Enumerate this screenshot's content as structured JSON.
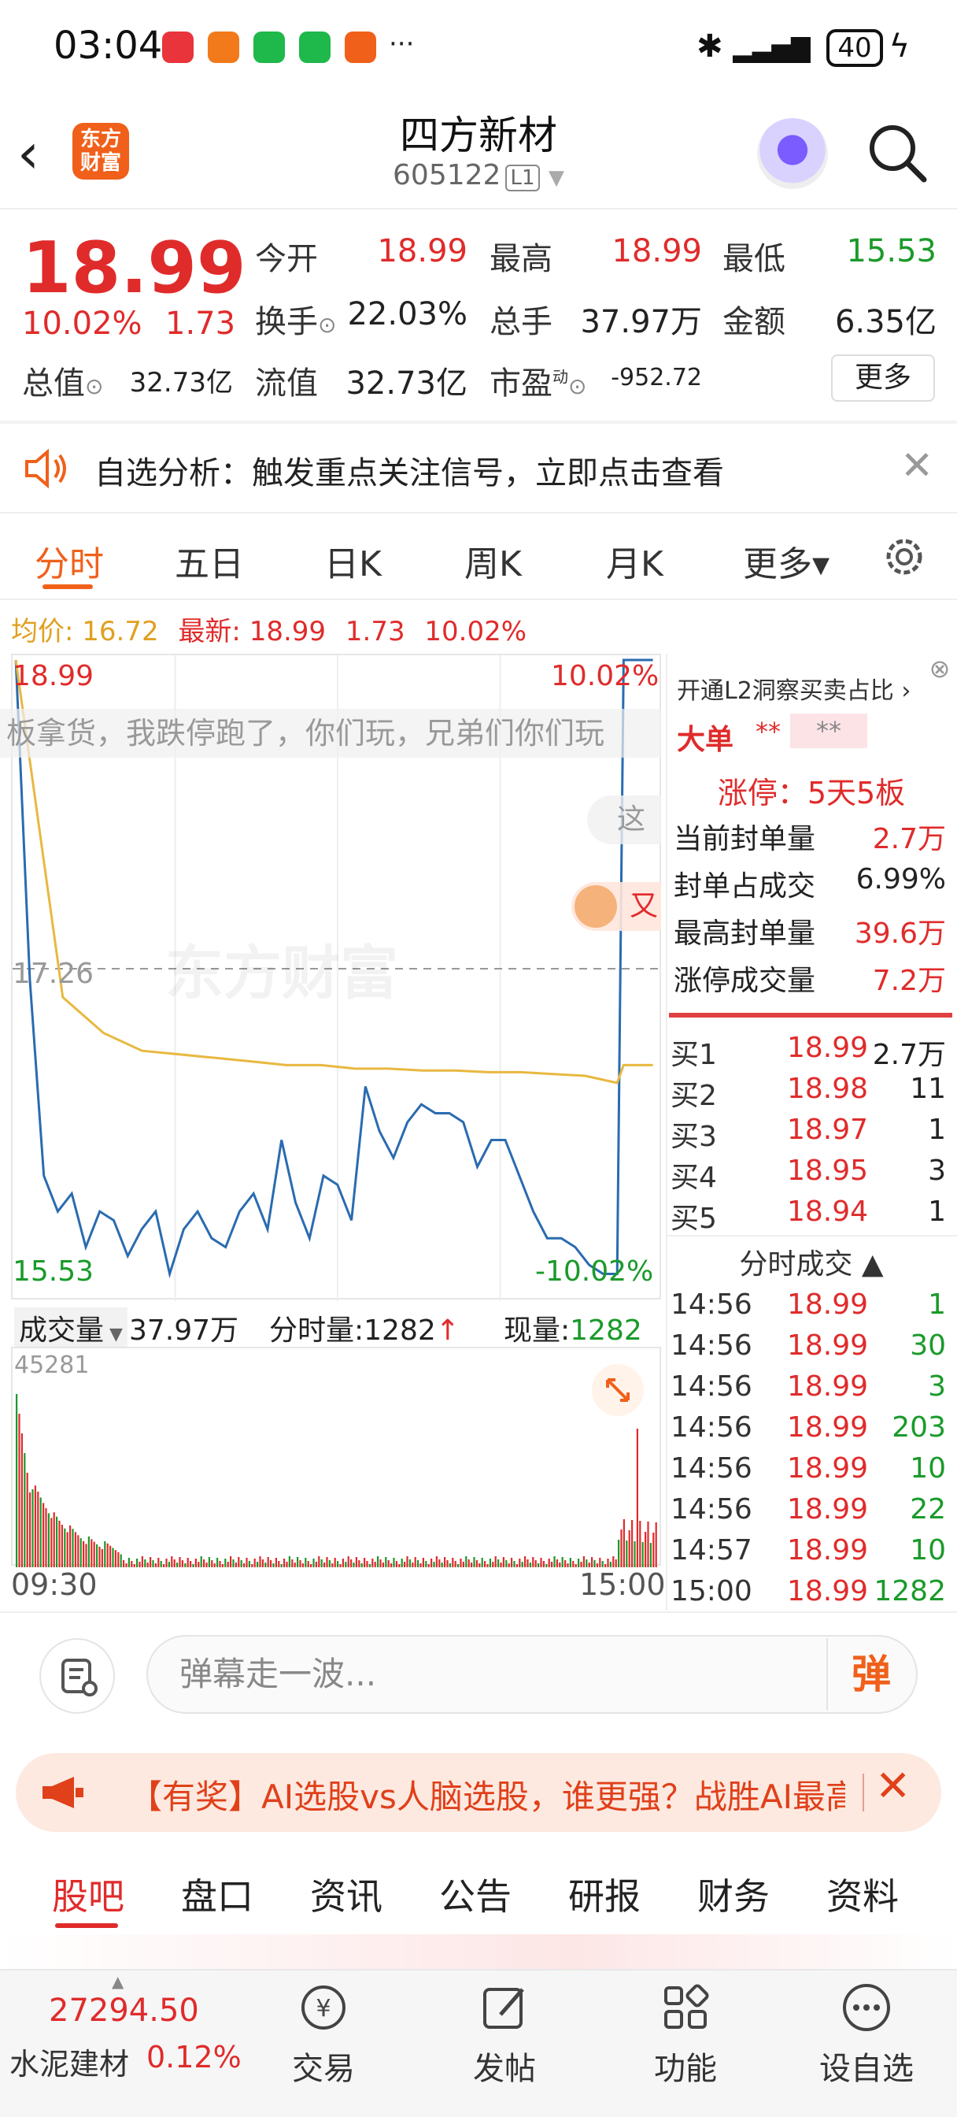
{
  "status": {
    "time": "03:04",
    "more": "···",
    "battery": "40"
  },
  "header": {
    "title": "四方新材",
    "code": "605122",
    "level": "L1",
    "logo_line1": "东方",
    "logo_line2": "财富"
  },
  "quote": {
    "price": "18.99",
    "pct": "10.02%",
    "change": "1.73",
    "fields": {
      "open_label": "今开",
      "open": "18.99",
      "high_label": "最高",
      "high": "18.99",
      "low_label": "最低",
      "low": "15.53",
      "turnover_label": "换手",
      "turnover": "22.03%",
      "volume_label": "总手",
      "volume": "37.97万",
      "amount_label": "金额",
      "amount": "6.35亿",
      "mktcap_label": "总值",
      "mktcap": "32.73亿",
      "float_label": "流值",
      "float": "32.73亿",
      "pe_label": "市盈",
      "pe_sup": "动",
      "pe": "-952.72"
    },
    "more_button": "更多"
  },
  "notice": {
    "text": "自选分析：触发重点关注信号，立即点击查看"
  },
  "chart_tabs": {
    "items": [
      "分时",
      "五日",
      "日K",
      "周K",
      "月K",
      "更多▾"
    ],
    "active": 0
  },
  "avg_line": {
    "avg_label": "均价:",
    "avg_value": "16.72",
    "last_label": "最新:",
    "last_value": "18.99",
    "last_change": "1.73",
    "last_pct": "10.02%"
  },
  "chart_overlay": {
    "danmu": "板拿货，我跌停跑了，你们玩，兄弟们你们玩",
    "danmu_partial": "这和",
    "danmu_partial2": "又",
    "watermark": "东方财富"
  },
  "chart_data": {
    "type": "line",
    "y_top_label": "18.99",
    "y_top_pct": "10.02%",
    "y_mid_label": "17.26",
    "y_bottom_label": "15.53",
    "y_bottom_pct": "-10.02%",
    "ylim": [
      15.53,
      18.99
    ],
    "x_start": "09:30",
    "x_end": "15:00",
    "series": [
      {
        "values": [
          18.99,
          17.2,
          16.1,
          15.9,
          16.0,
          15.7,
          15.9,
          15.85,
          15.65,
          15.8,
          15.9,
          15.55,
          15.8,
          15.9,
          15.75,
          15.7,
          15.9,
          16.0,
          15.8,
          16.3,
          15.95,
          15.75,
          16.1,
          16.05,
          15.85,
          16.6,
          16.35,
          16.2,
          16.4,
          16.5,
          16.45,
          16.45,
          16.4,
          16.15,
          16.3,
          16.3,
          16.1,
          15.9,
          15.75,
          15.75,
          15.7,
          15.6,
          15.55,
          15.55,
          18.99,
          18.99
        ]
      },
      {
        "values": [
          18.99,
          17.1,
          16.9,
          16.8,
          16.78,
          16.76,
          16.74,
          16.72,
          16.72,
          16.7,
          16.7,
          16.69,
          16.69,
          16.68,
          16.68,
          16.67,
          16.66,
          16.62,
          16.72,
          16.72
        ]
      }
    ]
  },
  "volume": {
    "label": "成交量",
    "total": "37.97万",
    "min_label": "分时量:",
    "min_value": "1282",
    "cur_label": "现量:",
    "cur_value": "1282",
    "max_label": "45281"
  },
  "l2": {
    "title": "开通L2洞察买卖占比 ›",
    "big_label": "大单",
    "stars1": "**",
    "stars2": "**",
    "limit_text": "涨停：5天5板",
    "rows": [
      {
        "label": "当前封单量",
        "value": "2.7万"
      },
      {
        "label": "封单占成交",
        "value": "6.99%"
      },
      {
        "label": "最高封单量",
        "value": "39.6万"
      },
      {
        "label": "涨停成交量",
        "value": "7.2万"
      }
    ]
  },
  "order_book": [
    {
      "label": "买1",
      "price": "18.99",
      "vol": "2.7万"
    },
    {
      "label": "买2",
      "price": "18.98",
      "vol": "11"
    },
    {
      "label": "买3",
      "price": "18.97",
      "vol": "1"
    },
    {
      "label": "买4",
      "price": "18.95",
      "vol": "3"
    },
    {
      "label": "买5",
      "price": "18.94",
      "vol": "1"
    }
  ],
  "ticks": {
    "header": "分时成交 ▲",
    "rows": [
      {
        "time": "14:56",
        "price": "18.99",
        "vol": "1"
      },
      {
        "time": "14:56",
        "price": "18.99",
        "vol": "30"
      },
      {
        "time": "14:56",
        "price": "18.99",
        "vol": "3"
      },
      {
        "time": "14:56",
        "price": "18.99",
        "vol": "203"
      },
      {
        "time": "14:56",
        "price": "18.99",
        "vol": "10"
      },
      {
        "time": "14:56",
        "price": "18.99",
        "vol": "22"
      },
      {
        "time": "14:57",
        "price": "18.99",
        "vol": "10"
      },
      {
        "time": "15:00",
        "price": "18.99",
        "vol": "1282"
      }
    ]
  },
  "comment": {
    "placeholder": "弹幕走一波...",
    "danmu_btn": "弹"
  },
  "promo": {
    "text": "【有奖】AI选股vs人脑选股，谁更强？战胜AI最高"
  },
  "bottom_tabs": {
    "items": [
      "股吧",
      "盘口",
      "资讯",
      "公告",
      "研报",
      "财务",
      "资料"
    ],
    "active": 0
  },
  "bottom_nav": {
    "index_value": "27294.50",
    "index_name": "水泥建材",
    "index_pct": "0.12%",
    "items": [
      "交易",
      "发帖",
      "功能",
      "设自选"
    ]
  }
}
